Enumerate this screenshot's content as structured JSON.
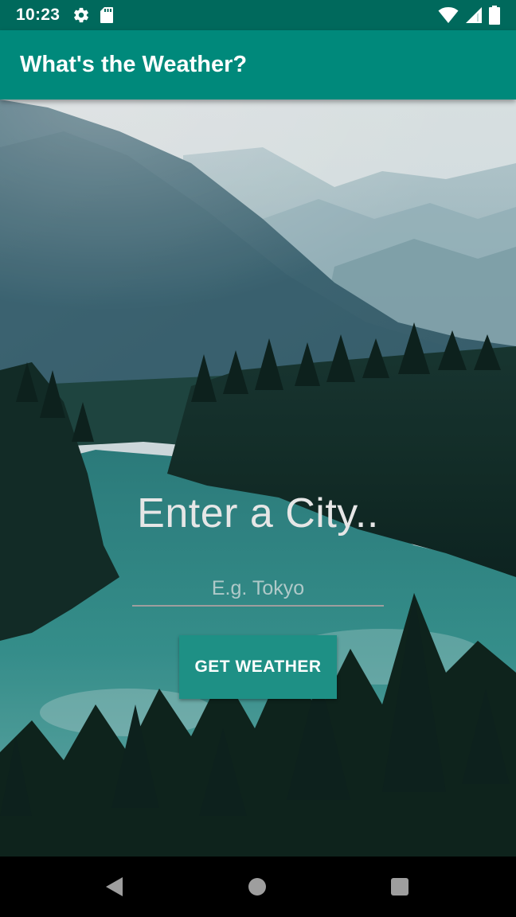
{
  "status_bar": {
    "time": "10:23",
    "left_icons": [
      "settings-icon",
      "sd-card-icon"
    ],
    "right_icons": [
      "wifi-icon",
      "cell-signal-icon",
      "battery-icon"
    ]
  },
  "app_bar": {
    "title": "What's the Weather?",
    "color": "#00897b"
  },
  "main": {
    "heading": "Enter a City..",
    "city_input": {
      "value": "",
      "placeholder": "E.g. Tokyo"
    },
    "get_weather_label": "GET WEATHER",
    "button_color": "#1e9085",
    "background_image": "mountain-lake-forest-photo"
  },
  "nav_bar": {
    "buttons": [
      "back-icon",
      "home-icon",
      "recents-icon"
    ]
  }
}
